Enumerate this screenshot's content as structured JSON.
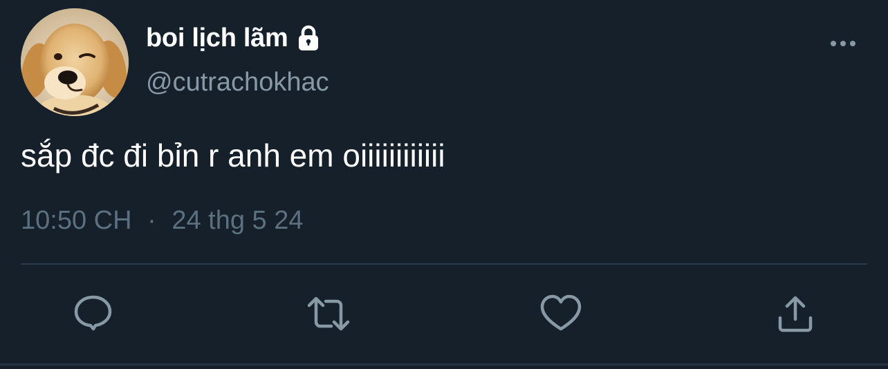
{
  "user": {
    "display_name": "boi lịch lãm",
    "handle": "@cutrachokhac",
    "avatar_icon": "golden-retriever-avatar",
    "protected_icon": "lock-icon"
  },
  "tweet": {
    "text": "sắp đc đi bỉn r anh em oiiiiiiiiiiii",
    "time": "10:50 CH",
    "separator": "·",
    "date": "24 thg 5 24"
  },
  "actions": {
    "reply_icon": "reply-icon",
    "retweet_icon": "retweet-icon",
    "like_icon": "like-icon",
    "share_icon": "share-icon",
    "more_icon": "more-options-icon"
  },
  "colors": {
    "background": "#15202b",
    "text_primary": "#ffffff",
    "text_secondary": "#8899a6",
    "icon": "#8899a6",
    "divider": "#2c3a47"
  }
}
